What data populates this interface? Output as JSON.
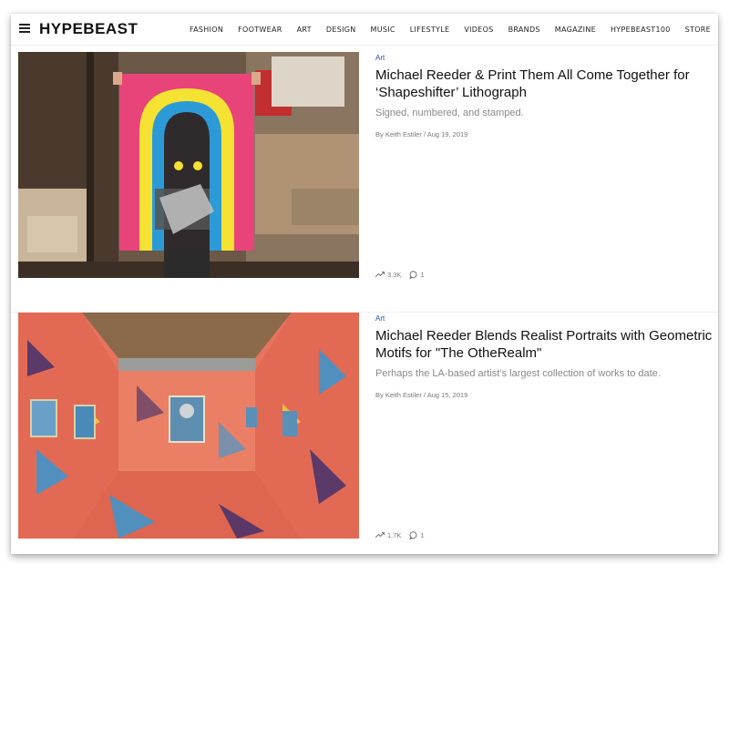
{
  "header": {
    "logo": "HYPEBEAST",
    "nav": [
      "FASHION",
      "FOOTWEAR",
      "ART",
      "DESIGN",
      "MUSIC",
      "LIFESTYLE",
      "VIDEOS",
      "BRANDS",
      "MAGAZINE",
      "HYPEBEAST100",
      "STORE"
    ]
  },
  "articles": [
    {
      "category": "Art",
      "title": "Michael Reeder & Print Them All Come Together for ‘Shapeshifter’ Lithograph",
      "subtitle": "Signed, numbered, and stamped.",
      "author": "By Keith Estiler",
      "date": "/ Aug 19, 2019",
      "views": "3.3K",
      "comments": "1"
    },
    {
      "category": "Art",
      "title": "Michael Reeder Blends Realist Portraits with Geometric Motifs for \"The OtheRealm\"",
      "subtitle": "Perhaps the LA-based artist’s largest collection of works to date.",
      "author": "By Keith Estiler",
      "date": "/ Aug 15, 2019",
      "views": "1.7K",
      "comments": "1"
    }
  ],
  "icons": {
    "menu": "hamburger-icon",
    "trending": "trending-icon",
    "comment": "comment-icon"
  },
  "colors": {
    "category": "#1a4fa6",
    "poster_pink": "#e8447a",
    "poster_yellow": "#f5e232",
    "poster_blue": "#2d9ad8",
    "gallery_salmon": "#e8735e"
  }
}
